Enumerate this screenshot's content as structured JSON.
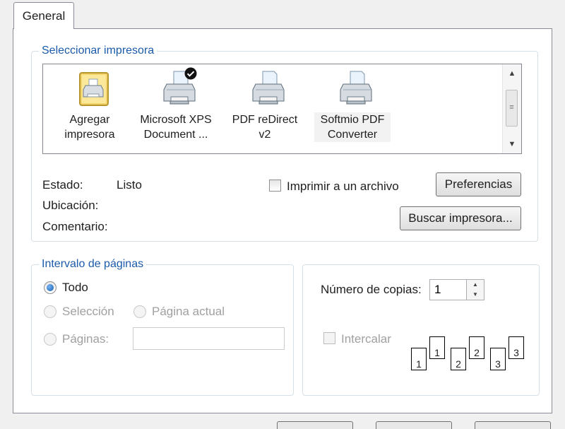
{
  "tabs": {
    "general": "General"
  },
  "select_printer": {
    "legend": "Seleccionar impresora",
    "printers": [
      {
        "label": "Agregar\nimpresora",
        "icon": "add-printer-icon"
      },
      {
        "label": "Microsoft XPS\nDocument ...",
        "icon": "printer-icon",
        "default": true
      },
      {
        "label": "PDF reDirect\nv2",
        "icon": "printer-icon"
      },
      {
        "label": "Softmio PDF\nConverter",
        "icon": "printer-icon",
        "selected": true
      }
    ],
    "status_label": "Estado:",
    "status_value": "Listo",
    "location_label": "Ubicación:",
    "comment_label": "Comentario:",
    "print_to_file_label": "Imprimir a un archivo",
    "print_to_file_checked": false,
    "preferences_button": "Preferencias",
    "find_printer_button": "Buscar impresora..."
  },
  "page_range": {
    "legend": "Intervalo de páginas",
    "all_label": "Todo",
    "selection_label": "Selección",
    "current_page_label": "Página actual",
    "pages_label": "Páginas:",
    "pages_value": ""
  },
  "copies": {
    "count_label": "Número de copias:",
    "count_value": "1",
    "collate_label": "Intercalar",
    "collate_checked": false,
    "collate_pages": [
      "1",
      "1",
      "2",
      "2",
      "3",
      "3"
    ]
  },
  "colors": {
    "accent": "#1c5bab",
    "border": "#898c95"
  }
}
